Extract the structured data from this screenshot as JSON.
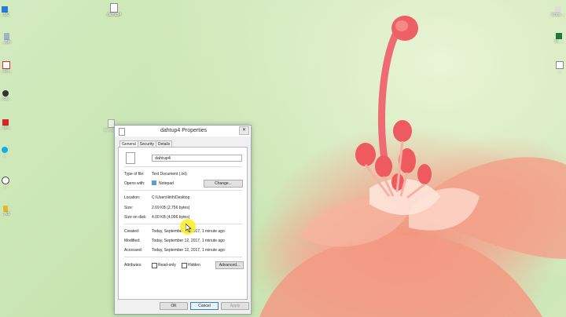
{
  "desktop": {
    "icons": [
      {
        "label": "dahtup4",
        "icon": "text-file-icon"
      },
      {
        "label": "...SC",
        "icon": "shortcut-icon"
      },
      {
        "label": "...Bin",
        "icon": "recycle-bin-icon"
      },
      {
        "label": "...Un...",
        "icon": "app-icon"
      },
      {
        "label": "...ce...",
        "icon": "app-icon"
      },
      {
        "label": "...ter...",
        "icon": "app-icon"
      },
      {
        "label": "...",
        "icon": "app-icon"
      },
      {
        "label": "...",
        "icon": "app-icon"
      },
      {
        "label": "...AS",
        "icon": "app-icon"
      },
      {
        "label": "dahtup4",
        "icon": "text-file-icon"
      }
    ],
    "right_icons": [
      {
        "label": "Icons ...",
        "icon": "app-icon"
      },
      {
        "label": "U..  ..",
        "icon": "excel-icon"
      },
      {
        "label": "...",
        "icon": "app-icon"
      }
    ]
  },
  "window": {
    "title": "dahtup4 Properties",
    "close_label": "✕",
    "tabs": [
      "General",
      "Security",
      "Details"
    ],
    "file_name": "dahtup4",
    "type_label": "Type of file:",
    "type_value": "Text Document (.txt)",
    "opens_label": "Opens with:",
    "opens_value": "Notepad",
    "change_label": "Change...",
    "location_label": "Location:",
    "location_value": "C:\\Users\\linh\\Desktop",
    "size_label": "Size:",
    "size_value": "2.69 KB (2,756 bytes)",
    "size_disk_label": "Size on disk:",
    "size_disk_value": "4.00 KB (4,096 bytes)",
    "created_label": "Created:",
    "created_value": "Today, September 12, 2017, 1 minute ago",
    "modified_label": "Modified:",
    "modified_value": "Today, September 12, 2017, 1 minute ago",
    "accessed_label": "Accessed:",
    "accessed_value": "Today, September 12, 2017, 1 minute ago",
    "attributes_label": "Attributes:",
    "readonly_label": "Read-only",
    "hidden_label": "Hidden",
    "advanced_label": "Advanced...",
    "ok_label": "OK",
    "cancel_label": "Cancel",
    "apply_label": "Apply"
  }
}
